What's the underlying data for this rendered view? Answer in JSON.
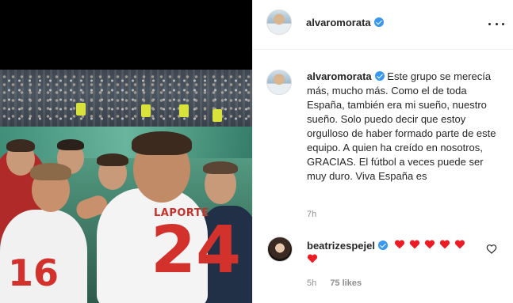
{
  "post": {
    "author": "alvaromorata",
    "caption": "Este grupo se merecía más, mucho más. Como el de toda España, también era mi sueño, nuestro sueño. Solo puedo decir que estoy orgulloso de haber formado parte de este equipo. A quien ha creído en nosotros, GRACIAS. El fútbol a veces puede ser muy duro. Viva España es",
    "time": "7h",
    "photo_jersey": {
      "name": "LAPORTE",
      "number": "24",
      "left_number": "16"
    }
  },
  "comment": {
    "author": "beatrizespejel",
    "hearts_count": 6,
    "time": "5h",
    "likes": "75 likes"
  },
  "icons": {
    "verified": "verified-badge-icon",
    "more": "more-options-icon",
    "heart_emoji": "red-heart-emoji",
    "like": "heart-outline-icon"
  },
  "colors": {
    "verified_blue": "#3897f0",
    "heart_red": "#ed1c24",
    "text": "#262626",
    "muted": "#8e8e8e"
  }
}
